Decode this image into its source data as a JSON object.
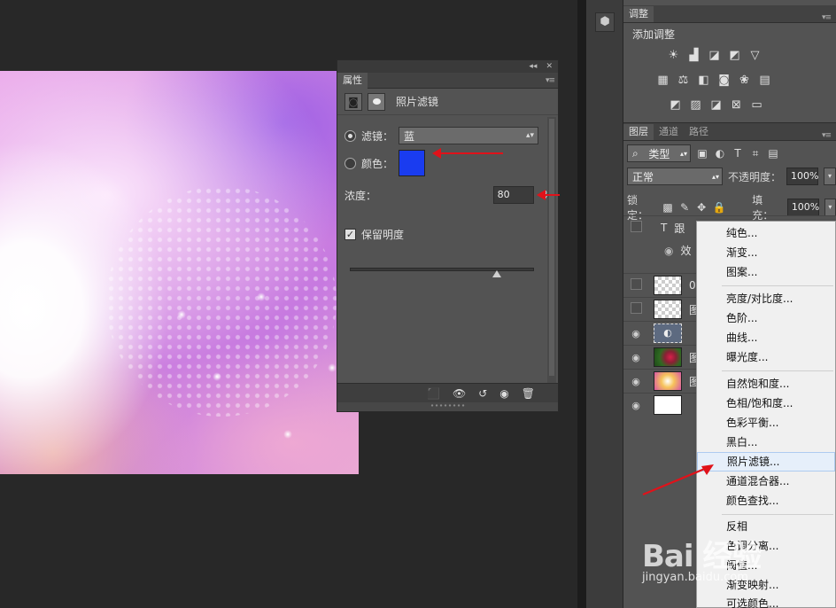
{
  "properties_panel": {
    "tab_label": "属性",
    "collapse_glyph": "◂◂",
    "close_glyph": "✕",
    "menu_glyph": "▾≡",
    "adjustment_title": "照片滤镜",
    "filter_label": "滤镜：",
    "filter_value": "蓝",
    "color_label": "颜色：",
    "color_value": "#1a3cf0",
    "selected_mode": "filter",
    "density_label": "浓度：",
    "density_value": "80",
    "density_unit": "%",
    "density_percent": 80,
    "preserve_luminosity_label": "保留明度",
    "preserve_luminosity_checked": true
  },
  "adjustments_panel": {
    "tab_label": "调整",
    "subtitle": "添加调整",
    "menu_glyph": "▾≡"
  },
  "layers_panel": {
    "tabs": [
      "图层",
      "通道",
      "路径"
    ],
    "menu_glyph": "▾≡",
    "filter_kind": "类型",
    "blend_mode": "正常",
    "opacity_label": "不透明度：",
    "opacity_value": "100%",
    "lock_label": "锁定：",
    "fill_label": "填充：",
    "fill_value": "100%",
    "layers": [
      {
        "visible": false,
        "kind": "text",
        "name": "跟",
        "thumb": "text"
      },
      {
        "visible": false,
        "kind": "effect",
        "name": "效",
        "thumb": "none"
      },
      {
        "visible": false,
        "kind": "image",
        "name": "0",
        "thumb": "checker"
      },
      {
        "visible": false,
        "kind": "image",
        "name": "图",
        "thumb": "checker"
      },
      {
        "visible": true,
        "kind": "adjustment",
        "name": "",
        "thumb": "adjust"
      },
      {
        "visible": true,
        "kind": "image",
        "name": "图",
        "thumb": "green"
      },
      {
        "visible": true,
        "kind": "image",
        "name": "图",
        "thumb": "pink"
      },
      {
        "visible": true,
        "kind": "image",
        "name": "",
        "thumb": "white"
      }
    ]
  },
  "context_menu": {
    "groups": [
      [
        "纯色...",
        "渐变...",
        "图案..."
      ],
      [
        "亮度/对比度...",
        "色阶...",
        "曲线...",
        "曝光度..."
      ],
      [
        "自然饱和度...",
        "色相/饱和度...",
        "色彩平衡...",
        "黑白...",
        "照片滤镜...",
        "通道混合器...",
        "颜色查找..."
      ],
      [
        "反相",
        "色调分离...",
        "阈值...",
        "渐变映射...",
        "可选颜色..."
      ]
    ],
    "highlighted": "照片滤镜..."
  },
  "watermark": {
    "logo": "Bai 经验",
    "url": "jingyan.baidu.com"
  },
  "colors": {
    "annotation_arrow": "#e0121a",
    "panel_bg": "#535353",
    "app_bg": "#282828",
    "menu_highlight": "#e6effa"
  }
}
